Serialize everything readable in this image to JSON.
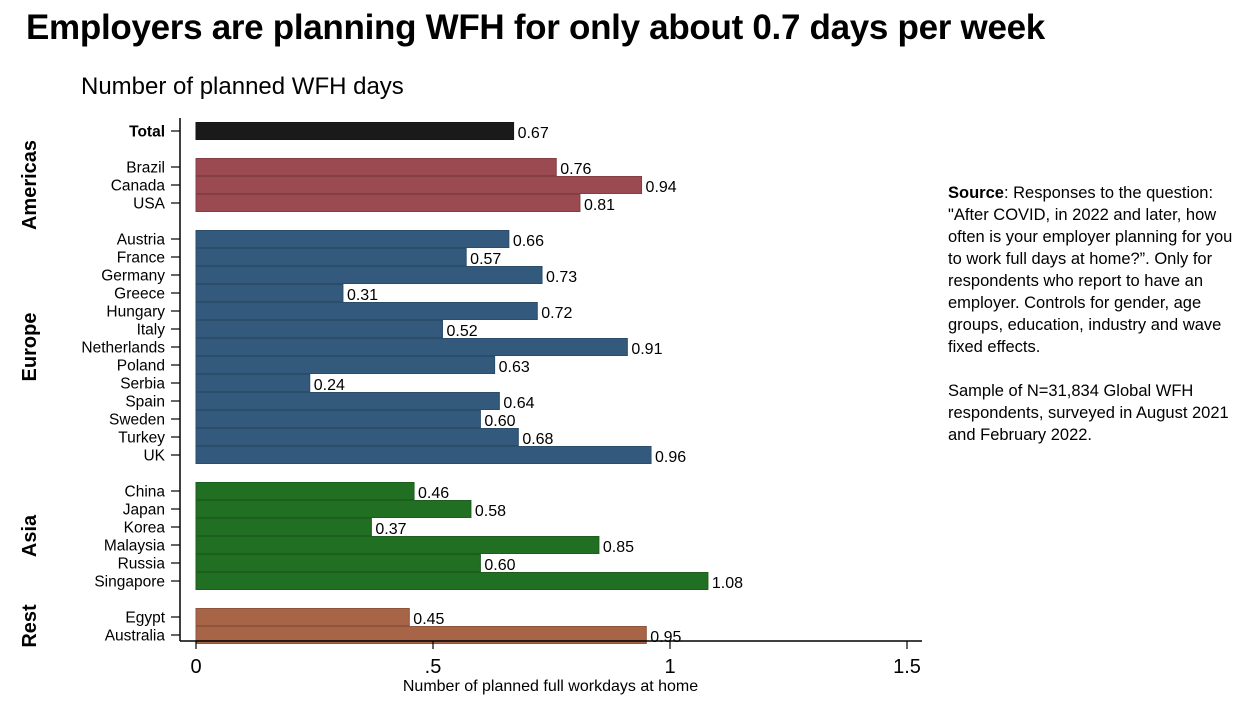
{
  "title": "Employers are planning WFH for only about 0.7 days per week",
  "note": {
    "source_label": "Source",
    "source_text": ": Responses to the question: \"After COVID, in 2022 and later, how often is your employer planning for you to work full days at home?”. Only for respondents who report to have an employer. Controls for gender, age groups, education, industry and wave fixed effects.",
    "sample_text": "Sample of N=31,834 Global WFH respondents, surveyed in August 2021 and February 2022."
  },
  "chart_data": {
    "type": "bar",
    "orientation": "horizontal",
    "title": "Number of planned WFH days",
    "xlabel": "Number of planned full workdays at home",
    "ylabel": "",
    "xlim": [
      0,
      1.5
    ],
    "xticks": [
      0,
      0.5,
      1,
      1.5
    ],
    "xtick_labels": [
      "0",
      ".5",
      "1",
      "1.5"
    ],
    "grid": false,
    "legend": "none",
    "groups": [
      {
        "name": "",
        "color": "#1a1a1a",
        "bold_labels": true,
        "categories": [
          "Total"
        ],
        "values": [
          0.67
        ],
        "labels": [
          "0.67"
        ]
      },
      {
        "name": "Americas",
        "color": "#9a4a50",
        "bold_labels": false,
        "categories": [
          "Brazil",
          "Canada",
          "USA"
        ],
        "values": [
          0.76,
          0.94,
          0.81
        ],
        "labels": [
          "0.76",
          "0.94",
          "0.81"
        ]
      },
      {
        "name": "Europe",
        "color": "#335a7c",
        "bold_labels": false,
        "categories": [
          "Austria",
          "France",
          "Germany",
          "Greece",
          "Hungary",
          "Italy",
          "Netherlands",
          "Poland",
          "Serbia",
          "Spain",
          "Sweden",
          "Turkey",
          "UK"
        ],
        "values": [
          0.66,
          0.57,
          0.73,
          0.31,
          0.72,
          0.52,
          0.91,
          0.63,
          0.24,
          0.64,
          0.6,
          0.68,
          0.96
        ],
        "labels": [
          "0.66",
          "0.57",
          "0.73",
          "0.31",
          "0.72",
          "0.52",
          "0.91",
          "0.63",
          "0.24",
          "0.64",
          "0.60",
          "0.68",
          "0.96"
        ]
      },
      {
        "name": "Asia",
        "color": "#206f22",
        "bold_labels": false,
        "categories": [
          "China",
          "Japan",
          "Korea",
          "Malaysia",
          "Russia",
          "Singapore"
        ],
        "values": [
          0.46,
          0.58,
          0.37,
          0.85,
          0.6,
          1.08
        ],
        "labels": [
          "0.46",
          "0.58",
          "0.37",
          "0.85",
          "0.60",
          "1.08"
        ]
      },
      {
        "name": "Rest",
        "color": "#a76447",
        "bold_labels": false,
        "categories": [
          "Egypt",
          "Australia"
        ],
        "values": [
          0.45,
          0.95
        ],
        "labels": [
          "0.45",
          "0.95"
        ]
      }
    ]
  }
}
